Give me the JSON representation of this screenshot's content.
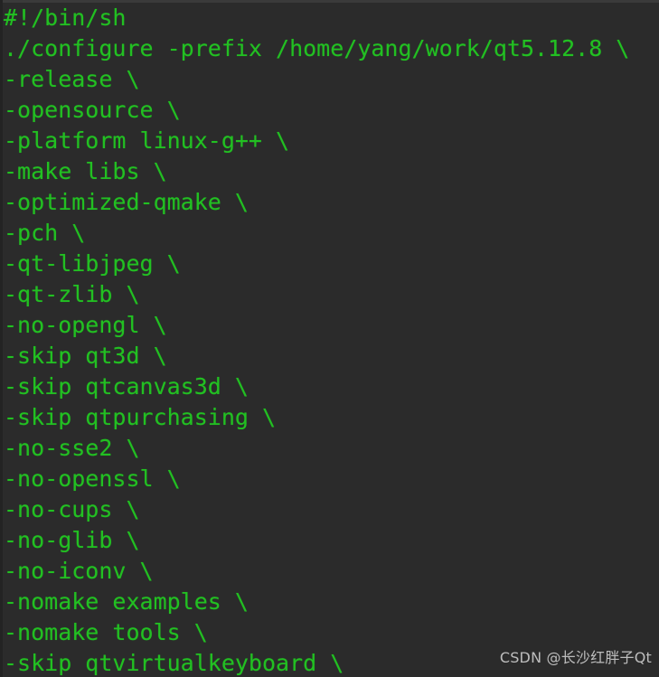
{
  "window": {
    "title": "qt5.12.8 configure shell script",
    "kind": "code-listing"
  },
  "colors": {
    "background": "#2b2b2b",
    "code_text": "#22c022",
    "top_chrome": "#3a3a3a",
    "left_gutter": "#232323",
    "watermark_text": "#d2d2d2"
  },
  "editor": {
    "language": "shell",
    "font_size_px": 25,
    "line_height_px": 34,
    "lines": [
      {
        "index": 1,
        "text": "#!/bin/sh"
      },
      {
        "index": 2,
        "text": "./configure -prefix /home/yang/work/qt5.12.8 \\"
      },
      {
        "index": 3,
        "text": "-release \\"
      },
      {
        "index": 4,
        "text": "-opensource \\"
      },
      {
        "index": 5,
        "text": "-platform linux-g++ \\"
      },
      {
        "index": 6,
        "text": "-make libs \\"
      },
      {
        "index": 7,
        "text": "-optimized-qmake \\"
      },
      {
        "index": 8,
        "text": "-pch \\"
      },
      {
        "index": 9,
        "text": "-qt-libjpeg \\"
      },
      {
        "index": 10,
        "text": "-qt-zlib \\"
      },
      {
        "index": 11,
        "text": "-no-opengl \\"
      },
      {
        "index": 12,
        "text": "-skip qt3d \\"
      },
      {
        "index": 13,
        "text": "-skip qtcanvas3d \\"
      },
      {
        "index": 14,
        "text": "-skip qtpurchasing \\"
      },
      {
        "index": 15,
        "text": "-no-sse2 \\"
      },
      {
        "index": 16,
        "text": "-no-openssl \\"
      },
      {
        "index": 17,
        "text": "-no-cups \\"
      },
      {
        "index": 18,
        "text": "-no-glib \\"
      },
      {
        "index": 19,
        "text": "-no-iconv \\"
      },
      {
        "index": 20,
        "text": "-nomake examples \\"
      },
      {
        "index": 21,
        "text": "-nomake tools \\"
      },
      {
        "index": 22,
        "text": "-skip qtvirtualkeyboard \\"
      }
    ]
  },
  "watermark": {
    "text": "CSDN @长沙红胖子Qt"
  }
}
